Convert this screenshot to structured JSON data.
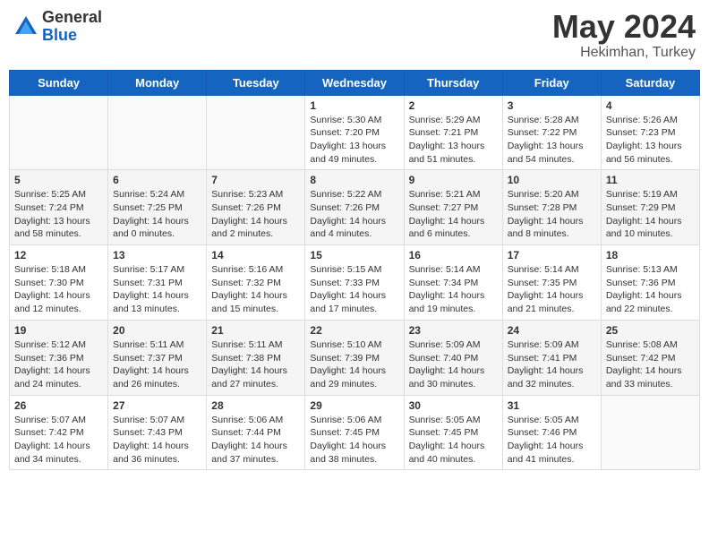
{
  "header": {
    "logo_general": "General",
    "logo_blue": "Blue",
    "month_year": "May 2024",
    "location": "Hekimhan, Turkey"
  },
  "weekdays": [
    "Sunday",
    "Monday",
    "Tuesday",
    "Wednesday",
    "Thursday",
    "Friday",
    "Saturday"
  ],
  "weeks": [
    [
      {
        "day": "",
        "info": ""
      },
      {
        "day": "",
        "info": ""
      },
      {
        "day": "",
        "info": ""
      },
      {
        "day": "1",
        "info": "Sunrise: 5:30 AM\nSunset: 7:20 PM\nDaylight: 13 hours\nand 49 minutes."
      },
      {
        "day": "2",
        "info": "Sunrise: 5:29 AM\nSunset: 7:21 PM\nDaylight: 13 hours\nand 51 minutes."
      },
      {
        "day": "3",
        "info": "Sunrise: 5:28 AM\nSunset: 7:22 PM\nDaylight: 13 hours\nand 54 minutes."
      },
      {
        "day": "4",
        "info": "Sunrise: 5:26 AM\nSunset: 7:23 PM\nDaylight: 13 hours\nand 56 minutes."
      }
    ],
    [
      {
        "day": "5",
        "info": "Sunrise: 5:25 AM\nSunset: 7:24 PM\nDaylight: 13 hours\nand 58 minutes."
      },
      {
        "day": "6",
        "info": "Sunrise: 5:24 AM\nSunset: 7:25 PM\nDaylight: 14 hours\nand 0 minutes."
      },
      {
        "day": "7",
        "info": "Sunrise: 5:23 AM\nSunset: 7:26 PM\nDaylight: 14 hours\nand 2 minutes."
      },
      {
        "day": "8",
        "info": "Sunrise: 5:22 AM\nSunset: 7:26 PM\nDaylight: 14 hours\nand 4 minutes."
      },
      {
        "day": "9",
        "info": "Sunrise: 5:21 AM\nSunset: 7:27 PM\nDaylight: 14 hours\nand 6 minutes."
      },
      {
        "day": "10",
        "info": "Sunrise: 5:20 AM\nSunset: 7:28 PM\nDaylight: 14 hours\nand 8 minutes."
      },
      {
        "day": "11",
        "info": "Sunrise: 5:19 AM\nSunset: 7:29 PM\nDaylight: 14 hours\nand 10 minutes."
      }
    ],
    [
      {
        "day": "12",
        "info": "Sunrise: 5:18 AM\nSunset: 7:30 PM\nDaylight: 14 hours\nand 12 minutes."
      },
      {
        "day": "13",
        "info": "Sunrise: 5:17 AM\nSunset: 7:31 PM\nDaylight: 14 hours\nand 13 minutes."
      },
      {
        "day": "14",
        "info": "Sunrise: 5:16 AM\nSunset: 7:32 PM\nDaylight: 14 hours\nand 15 minutes."
      },
      {
        "day": "15",
        "info": "Sunrise: 5:15 AM\nSunset: 7:33 PM\nDaylight: 14 hours\nand 17 minutes."
      },
      {
        "day": "16",
        "info": "Sunrise: 5:14 AM\nSunset: 7:34 PM\nDaylight: 14 hours\nand 19 minutes."
      },
      {
        "day": "17",
        "info": "Sunrise: 5:14 AM\nSunset: 7:35 PM\nDaylight: 14 hours\nand 21 minutes."
      },
      {
        "day": "18",
        "info": "Sunrise: 5:13 AM\nSunset: 7:36 PM\nDaylight: 14 hours\nand 22 minutes."
      }
    ],
    [
      {
        "day": "19",
        "info": "Sunrise: 5:12 AM\nSunset: 7:36 PM\nDaylight: 14 hours\nand 24 minutes."
      },
      {
        "day": "20",
        "info": "Sunrise: 5:11 AM\nSunset: 7:37 PM\nDaylight: 14 hours\nand 26 minutes."
      },
      {
        "day": "21",
        "info": "Sunrise: 5:11 AM\nSunset: 7:38 PM\nDaylight: 14 hours\nand 27 minutes."
      },
      {
        "day": "22",
        "info": "Sunrise: 5:10 AM\nSunset: 7:39 PM\nDaylight: 14 hours\nand 29 minutes."
      },
      {
        "day": "23",
        "info": "Sunrise: 5:09 AM\nSunset: 7:40 PM\nDaylight: 14 hours\nand 30 minutes."
      },
      {
        "day": "24",
        "info": "Sunrise: 5:09 AM\nSunset: 7:41 PM\nDaylight: 14 hours\nand 32 minutes."
      },
      {
        "day": "25",
        "info": "Sunrise: 5:08 AM\nSunset: 7:42 PM\nDaylight: 14 hours\nand 33 minutes."
      }
    ],
    [
      {
        "day": "26",
        "info": "Sunrise: 5:07 AM\nSunset: 7:42 PM\nDaylight: 14 hours\nand 34 minutes."
      },
      {
        "day": "27",
        "info": "Sunrise: 5:07 AM\nSunset: 7:43 PM\nDaylight: 14 hours\nand 36 minutes."
      },
      {
        "day": "28",
        "info": "Sunrise: 5:06 AM\nSunset: 7:44 PM\nDaylight: 14 hours\nand 37 minutes."
      },
      {
        "day": "29",
        "info": "Sunrise: 5:06 AM\nSunset: 7:45 PM\nDaylight: 14 hours\nand 38 minutes."
      },
      {
        "day": "30",
        "info": "Sunrise: 5:05 AM\nSunset: 7:45 PM\nDaylight: 14 hours\nand 40 minutes."
      },
      {
        "day": "31",
        "info": "Sunrise: 5:05 AM\nSunset: 7:46 PM\nDaylight: 14 hours\nand 41 minutes."
      },
      {
        "day": "",
        "info": ""
      }
    ]
  ]
}
